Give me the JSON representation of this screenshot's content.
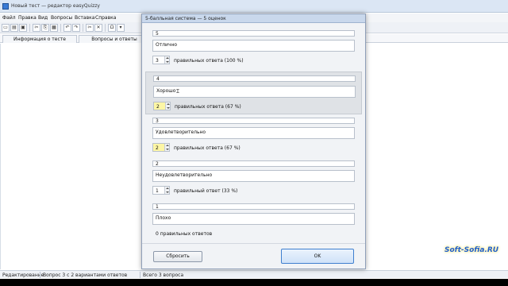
{
  "window": {
    "title": "Новый тест — редактор easyQuizzy"
  },
  "menu": [
    "Файл",
    "Правка",
    "Вид",
    "Вопросы",
    "Вставка",
    "Справка"
  ],
  "toolbar": {
    "buttons": [
      "new",
      "open",
      "save",
      "cut",
      "copy",
      "paste",
      "undo",
      "redo",
      "cut-x",
      "cross",
      "omega",
      "more"
    ],
    "glyphs": [
      "▭",
      "▤",
      "▣",
      "✂",
      "⎘",
      "▦",
      "↶",
      "↷",
      "✂",
      "✕",
      "Ω",
      "▾"
    ]
  },
  "tabs": [
    {
      "label": "Информация о тесте"
    },
    {
      "label": "Вопросы и ответы"
    }
  ],
  "status": {
    "mode": "Редактирование",
    "question": "Вопрос 3 с 2 вариантами ответов",
    "total": "Всего 3 вопроса"
  },
  "dialog": {
    "title": "5-балльная система — 5 оценок",
    "grades": [
      {
        "score": "5",
        "name": "Отлично",
        "count": "3",
        "answers_label": "правильных ответа (100 %)",
        "highlight": false,
        "selected": false
      },
      {
        "score": "4",
        "name": "Хорошо",
        "count": "2",
        "answers_label": "правильных ответа (67 %)",
        "highlight": true,
        "selected": true
      },
      {
        "score": "3",
        "name": "Удовлетворительно",
        "count": "2",
        "answers_label": "правильных ответа (67 %)",
        "highlight": true,
        "selected": false
      },
      {
        "score": "2",
        "name": "Неудовлетворительно",
        "count": "1",
        "answers_label": "правильный ответ (33 %)",
        "highlight": false,
        "selected": false
      },
      {
        "score": "1",
        "name": "Плохо",
        "static_label": "0 правильных ответов"
      }
    ],
    "reset_label": "Сбросить",
    "ok_label": "OK"
  },
  "watermark": "Soft-Sofia.RU",
  "colors": {
    "stepper_highlight": "#fdf6a5",
    "ok_border": "#3f7fcf",
    "selected_block": "#dfe2e6"
  }
}
